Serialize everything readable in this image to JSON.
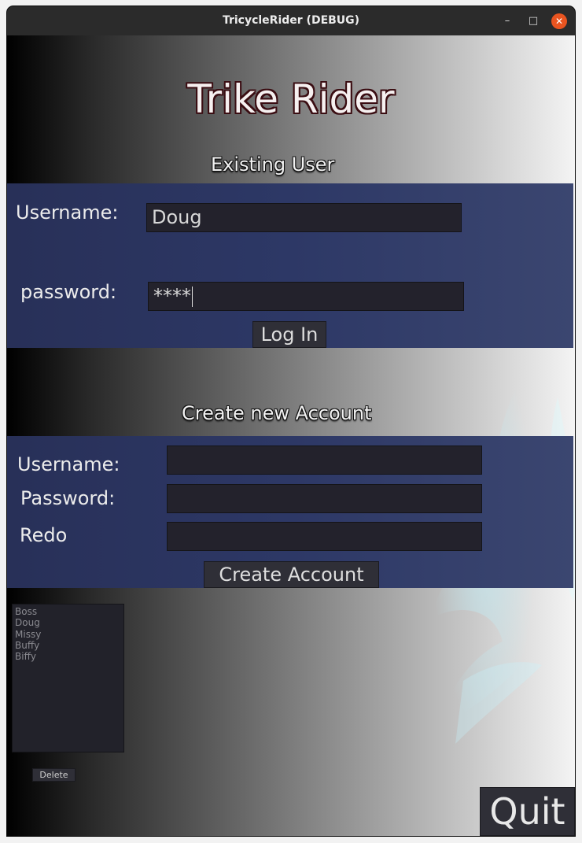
{
  "window": {
    "title": "TricycleRider (DEBUG)",
    "minimize_glyph": "–",
    "maximize_glyph": "□",
    "close_glyph": "✕"
  },
  "app": {
    "title": "Trike Rider"
  },
  "login": {
    "section_title": "Existing User",
    "username_label": "Username:",
    "username_value": "Doug",
    "password_label": "password:",
    "password_value": "****",
    "login_button": "Log In"
  },
  "create": {
    "section_title": "Create new Account",
    "username_label": "Username:",
    "username_value": "",
    "password_label": "Password:",
    "password_value": "",
    "redo_label": "Redo",
    "redo_value": "",
    "create_button": "Create Account"
  },
  "users": {
    "items": [
      "Boss",
      "Doug",
      "Missy",
      "Buffy",
      "Biffy"
    ],
    "delete_button": "Delete"
  },
  "quit_button": "Quit",
  "colors": {
    "panel": "#2d3866",
    "input_bg": "#23222c",
    "button_bg": "#2f2f37",
    "title_outline": "#3a0d12",
    "close_button": "#e95420"
  }
}
